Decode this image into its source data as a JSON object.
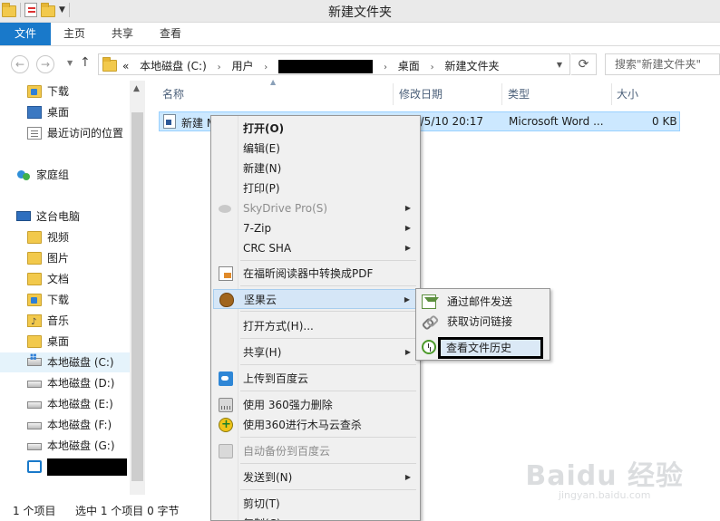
{
  "window": {
    "title": "新建文件夹"
  },
  "ribbon": {
    "file_tab": "文件",
    "tabs": [
      "主页",
      "共享",
      "查看"
    ]
  },
  "nav": {
    "path": [
      "本地磁盘 (C:)",
      "用户",
      "桌面",
      "新建文件夹"
    ],
    "overflow": "«",
    "search_placeholder": "搜索\"新建文件夹\""
  },
  "sidebar": {
    "items": [
      {
        "label": "下载",
        "icon": "download-folder-icon"
      },
      {
        "label": "桌面",
        "icon": "desktop-icon"
      },
      {
        "label": "最近访问的位置",
        "icon": "recent-places-icon"
      },
      {
        "label": "家庭组",
        "icon": "homegroup-icon"
      },
      {
        "label": "这台电脑",
        "icon": "computer-icon"
      },
      {
        "label": "视频",
        "icon": "videos-folder-icon"
      },
      {
        "label": "图片",
        "icon": "pictures-folder-icon"
      },
      {
        "label": "文档",
        "icon": "documents-folder-icon"
      },
      {
        "label": "下载",
        "icon": "download-folder-icon"
      },
      {
        "label": "音乐",
        "icon": "music-folder-icon"
      },
      {
        "label": "桌面",
        "icon": "desktop-folder-icon"
      },
      {
        "label": "本地磁盘 (C:)",
        "icon": "drive-c-icon"
      },
      {
        "label": "本地磁盘 (D:)",
        "icon": "drive-icon"
      },
      {
        "label": "本地磁盘 (E:)",
        "icon": "drive-icon"
      },
      {
        "label": "本地磁盘 (F:)",
        "icon": "drive-icon"
      },
      {
        "label": "本地磁盘 (G:)",
        "icon": "drive-icon"
      }
    ]
  },
  "files": {
    "columns": [
      "名称",
      "修改日期",
      "类型",
      "大小"
    ],
    "rows": [
      {
        "name": "新建 M",
        "modified": "5/5/10 20:17",
        "type": "Microsoft Word ...",
        "size": "0 KB"
      }
    ]
  },
  "status": {
    "count": "1 个项目",
    "selected": "选中 1 个项目 0 字节"
  },
  "context_menu": {
    "items": [
      {
        "label": "打开(O)",
        "bold": true
      },
      {
        "label": "编辑(E)"
      },
      {
        "label": "新建(N)"
      },
      {
        "label": "打印(P)"
      },
      {
        "label": "SkyDrive Pro(S)",
        "disabled": true,
        "submenu": true,
        "icon": "skydrive-cloud-icon"
      },
      {
        "label": "7-Zip",
        "submenu": true
      },
      {
        "label": "CRC SHA",
        "submenu": true
      },
      {
        "label": "在福昕阅读器中转换成PDF",
        "icon": "pdf-convert-icon"
      },
      {
        "label": "坚果云",
        "submenu": true,
        "icon": "nutstore-icon"
      },
      {
        "label": "打开方式(H)..."
      },
      {
        "label": "共享(H)",
        "submenu": true
      },
      {
        "label": "上传到百度云",
        "icon": "baidu-cloud-icon"
      },
      {
        "label": "使用 360强力删除",
        "icon": "shredder-icon"
      },
      {
        "label": "使用360进行木马云查杀",
        "icon": "360-scan-icon"
      },
      {
        "label": "自动备份到百度云",
        "disabled": true,
        "icon": "baidu-backup-icon"
      },
      {
        "label": "发送到(N)",
        "submenu": true
      },
      {
        "label": "剪切(T)"
      },
      {
        "label": "复制(C)"
      }
    ]
  },
  "submenu": {
    "items": [
      {
        "label": "通过邮件发送",
        "icon": "mail-icon"
      },
      {
        "label": "获取访问链接",
        "icon": "link-icon"
      },
      {
        "label": "查看文件历史",
        "icon": "history-clock-icon"
      }
    ]
  },
  "watermark": {
    "brand": "Baidu 经验",
    "url": "jingyan.baidu.com"
  }
}
